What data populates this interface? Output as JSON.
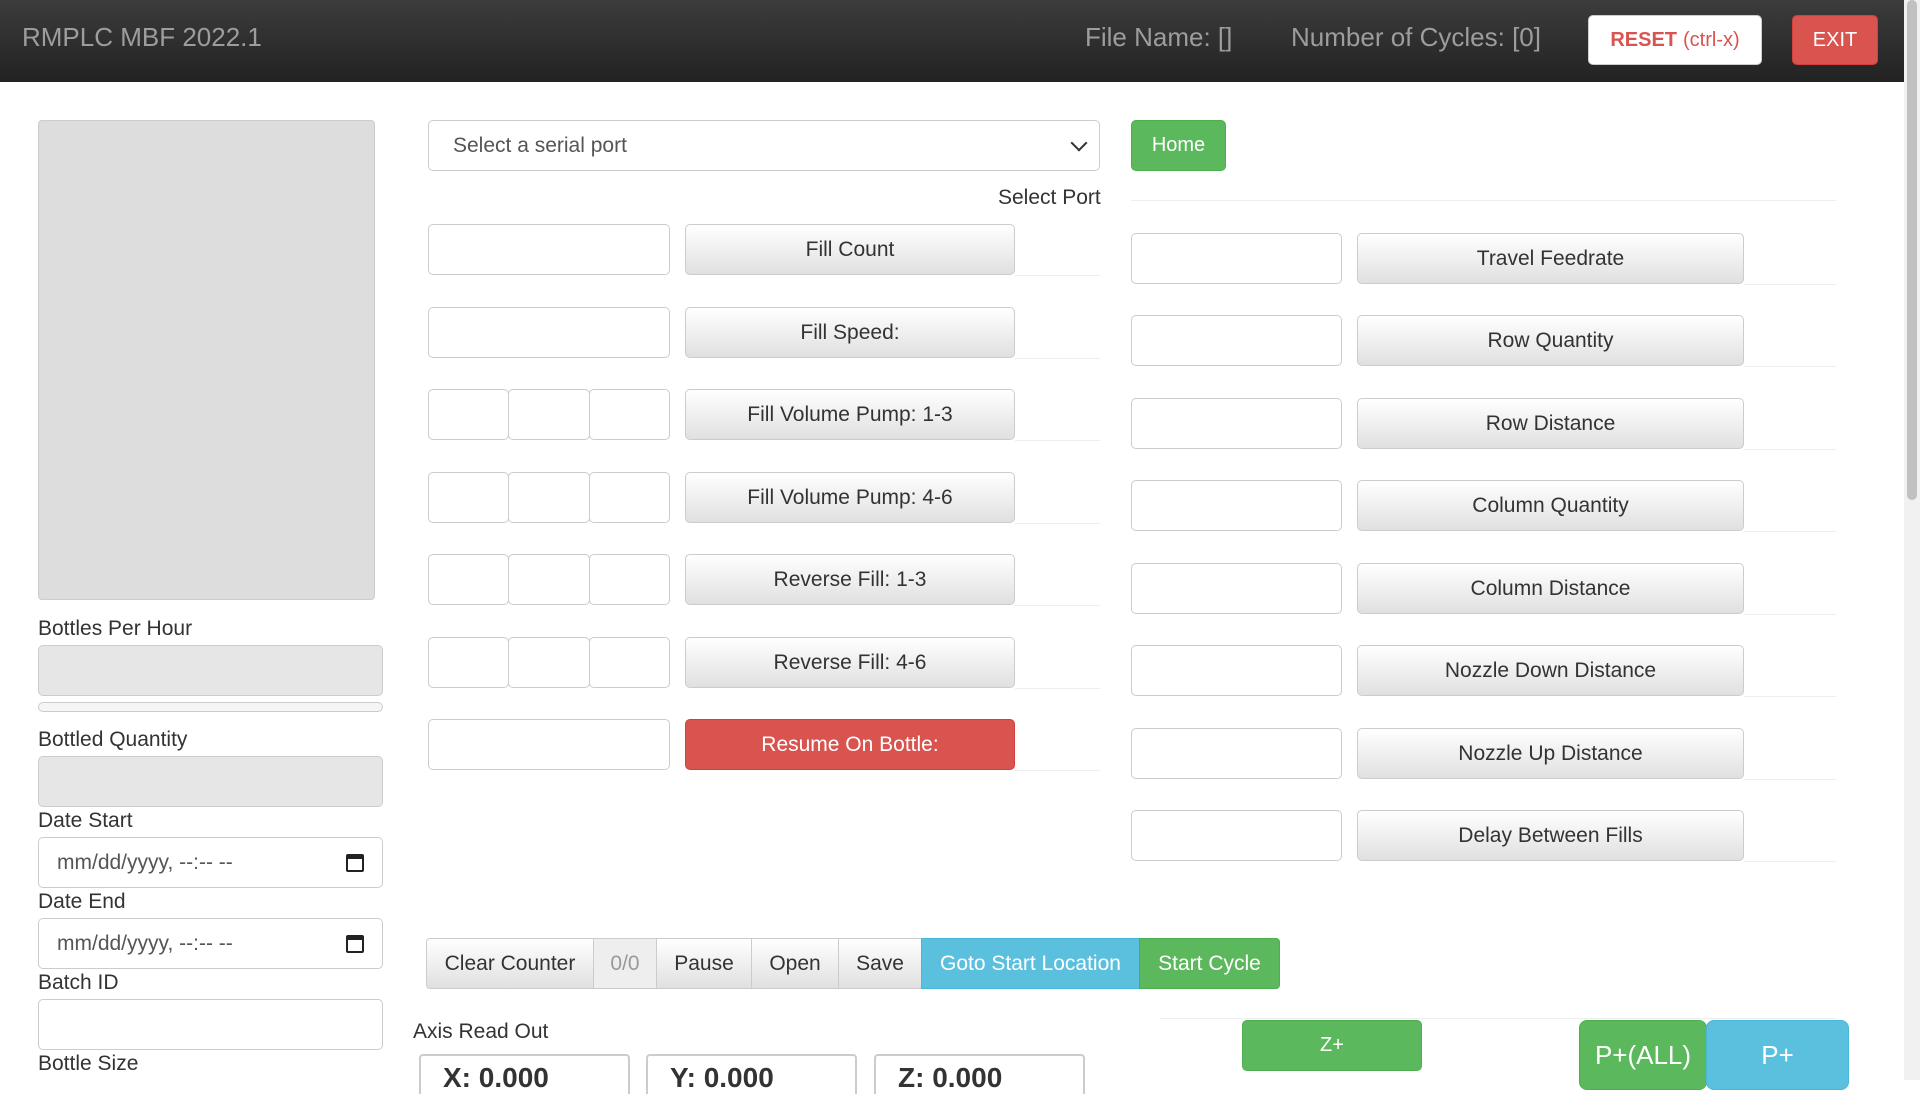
{
  "header": {
    "brand": "RMPLC MBF 2022.1",
    "file_name": "File Name: []",
    "cycles": "Number of Cycles: [0]",
    "reset_label": "RESET",
    "reset_shortcut": "(ctrl-x)",
    "exit_label": "EXIT"
  },
  "left": {
    "bottles_per_hour_label": "Bottles Per Hour",
    "bottled_quantity_label": "Bottled Quantity",
    "date_start_label": "Date Start",
    "date_start_placeholder": "mm/dd/yyyy, --:-- --",
    "date_end_label": "Date End",
    "date_end_placeholder": "mm/dd/yyyy, --:-- --",
    "batch_id_label": "Batch ID",
    "bottle_size_label": "Bottle Size"
  },
  "middle": {
    "serial_select": "Select a serial port",
    "select_port_label": "Select Port",
    "fill_count": "Fill Count",
    "fill_speed": "Fill Speed:",
    "fill_volume_1_3": "Fill Volume Pump: 1-3",
    "fill_volume_4_6": "Fill Volume Pump: 4-6",
    "reverse_fill_1_3": "Reverse Fill: 1-3",
    "reverse_fill_4_6": "Reverse Fill: 4-6",
    "resume_on_bottle": "Resume On Bottle:"
  },
  "right": {
    "home": "Home",
    "travel_feedrate": "Travel Feedrate",
    "row_quantity": "Row Quantity",
    "row_distance": "Row Distance",
    "column_quantity": "Column Quantity",
    "column_distance": "Column Distance",
    "nozzle_down_distance": "Nozzle Down Distance",
    "nozzle_up_distance": "Nozzle Up Distance",
    "delay_between_fills": "Delay Between Fills"
  },
  "controls": {
    "clear_counter": "Clear Counter",
    "counter": "0/0",
    "pause": "Pause",
    "open": "Open",
    "save": "Save",
    "goto_start": "Goto Start Location",
    "start_cycle": "Start Cycle"
  },
  "axis": {
    "label": "Axis Read Out",
    "x": "X: 0.000",
    "y": "Y: 0.000",
    "z": "Z: 0.000"
  },
  "jog": {
    "z_plus": "Z+",
    "p_all": "P+(ALL)",
    "p_plus": "P+"
  }
}
